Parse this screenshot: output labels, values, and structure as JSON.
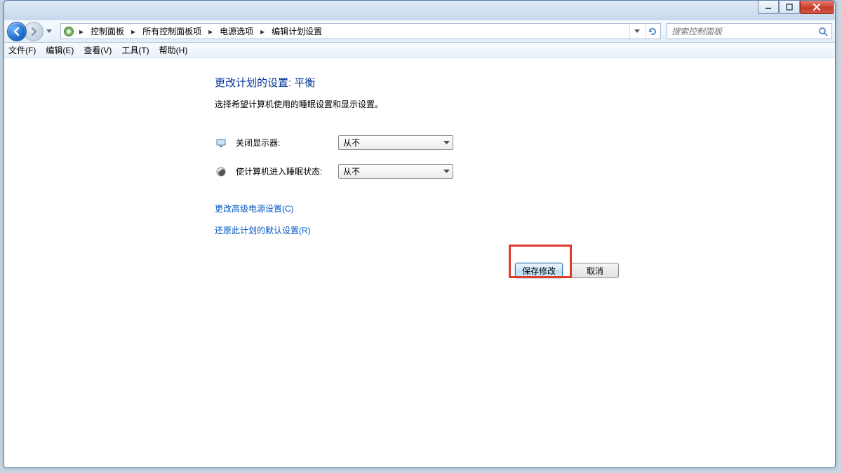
{
  "breadcrumb": {
    "items": [
      "控制面板",
      "所有控制面板项",
      "电源选项",
      "编辑计划设置"
    ]
  },
  "search": {
    "placeholder": "搜索控制面板"
  },
  "menu": {
    "file": "文件(F)",
    "edit": "编辑(E)",
    "view": "查看(V)",
    "tools": "工具(T)",
    "help": "帮助(H)"
  },
  "page": {
    "title": "更改计划的设置: 平衡",
    "subtitle": "选择希望计算机使用的睡眠设置和显示设置。"
  },
  "settings": {
    "display": {
      "label": "关闭显示器:",
      "value": "从不"
    },
    "sleep": {
      "label": "使计算机进入睡眠状态:",
      "value": "从不"
    }
  },
  "links": {
    "advanced": "更改高级电源设置(C)",
    "restore": "还原此计划的默认设置(R)"
  },
  "buttons": {
    "save": "保存修改",
    "cancel": "取消"
  }
}
